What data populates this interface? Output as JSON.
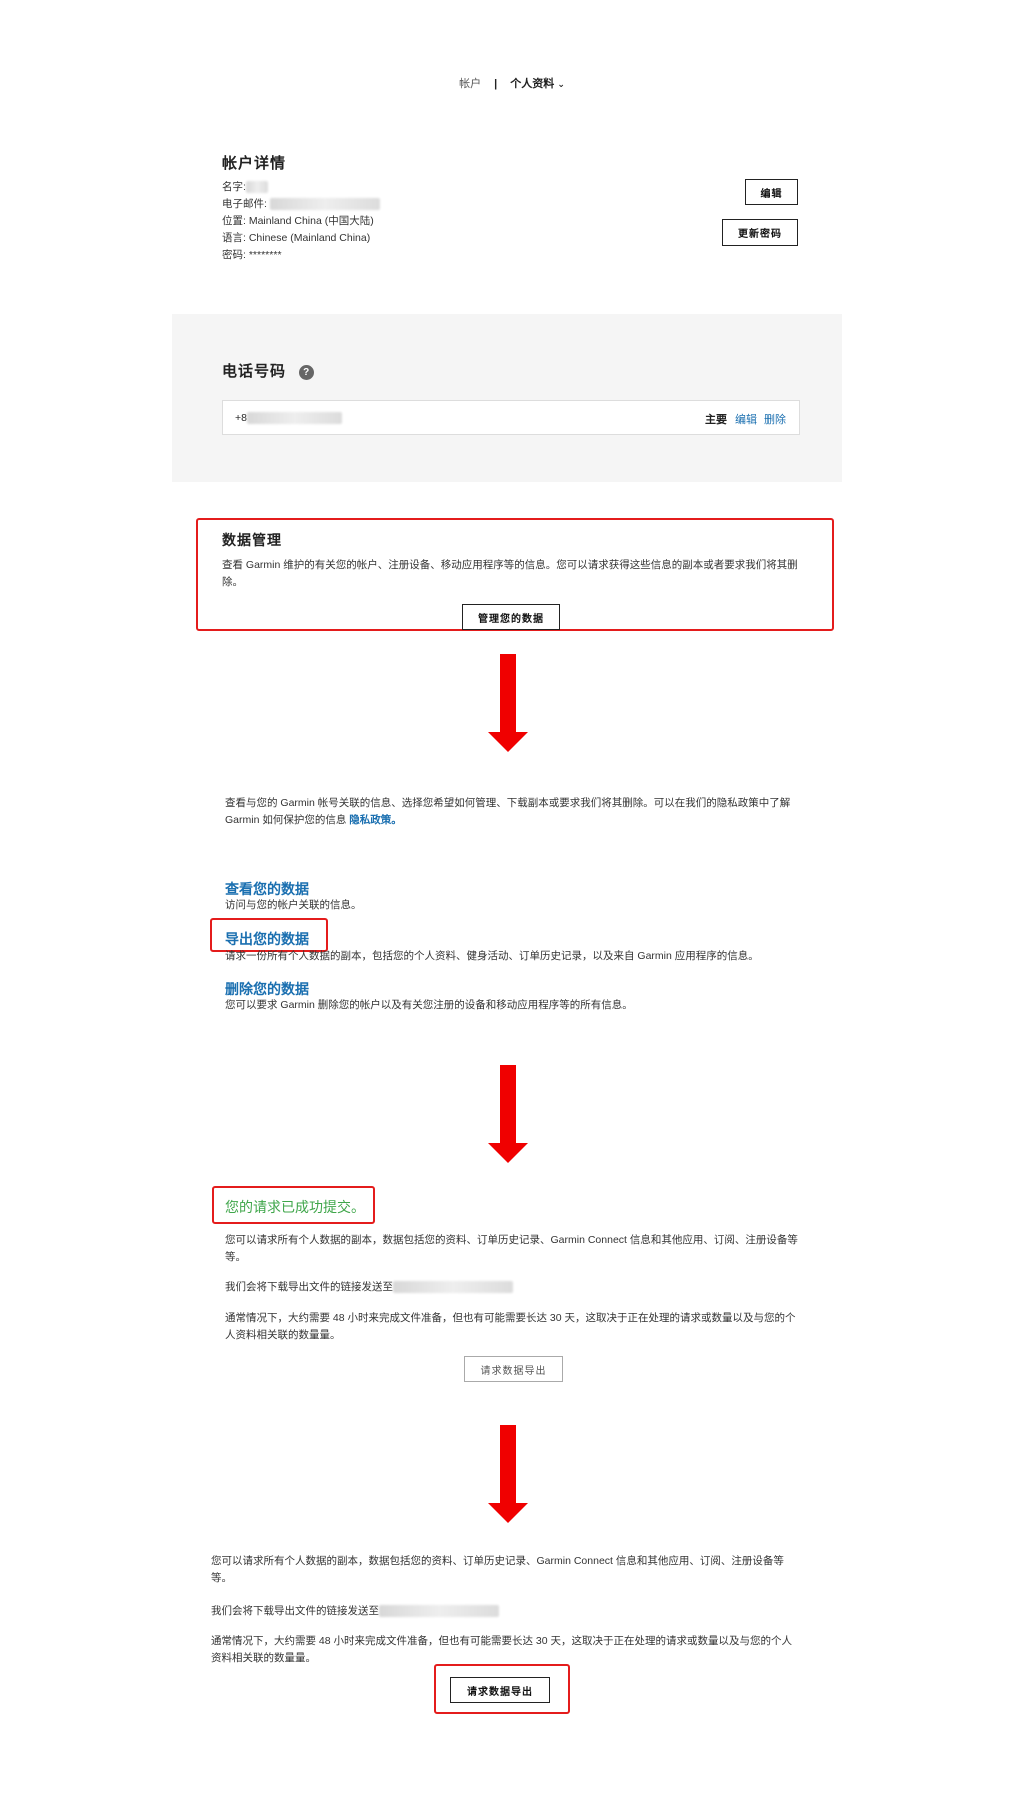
{
  "nav": {
    "account": "帐户",
    "separator": "|",
    "profile": "个人资料"
  },
  "account_details": {
    "title": "帐户详情",
    "name_label": "名字:",
    "email_label": "电子邮件:",
    "location": "位置: Mainland China (中国大陆)",
    "language": "语言: Chinese (Mainland China)",
    "password": "密码: ********",
    "edit_button": "编辑",
    "update_password_button": "更新密码"
  },
  "phone": {
    "title": "电话号码",
    "help_glyph": "?",
    "number_prefix": "+8",
    "primary": "主要",
    "edit": "编辑",
    "delete": "删除"
  },
  "data_management": {
    "title": "数据管理",
    "description": "查看 Garmin 维护的有关您的帐户、注册设备、移动应用程序等的信息。您可以请求获得这些信息的副本或者要求我们将其删除。",
    "button": "管理您的数据"
  },
  "manage_page": {
    "intro": "查看与您的 Garmin 帐号关联的信息、选择您希望如何管理、下载副本或要求我们将其删除。可以在我们的隐私政策中了解 Garmin 如何保护您的信息",
    "privacy_link": "隐私政策。",
    "view_title": "查看您的数据",
    "view_desc": "访问与您的帐户关联的信息。",
    "export_title": "导出您的数据",
    "export_desc": "请求一份所有个人数据的副本，包括您的个人资料、健身活动、订单历史记录，以及来自 Garmin 应用程序的信息。",
    "delete_title": "删除您的数据",
    "delete_desc": "您可以要求 Garmin 删除您的帐户以及有关您注册的设备和移动应用程序等的所有信息。"
  },
  "success_page": {
    "success": "您的请求已成功提交。",
    "p1": "您可以请求所有个人数据的副本，数据包括您的资料、订单历史记录、Garmin Connect 信息和其他应用、订阅、注册设备等等。",
    "p2": "我们会将下载导出文件的链接发送至",
    "p3": "通常情况下，大约需要 48 小时来完成文件准备，但也有可能需要长达 30 天，这取决于正在处理的请求或数量以及与您的个人资料相关联的数量量。",
    "button": "请求数据导出"
  },
  "request_page": {
    "p1": "您可以请求所有个人数据的副本，数据包括您的资料、订单历史记录、Garmin Connect 信息和其他应用、订阅、注册设备等等。",
    "p2": "我们会将下载导出文件的链接发送至",
    "p3": "通常情况下，大约需要 48 小时来完成文件准备，但也有可能需要长达 30 天，这取决于正在处理的请求或数量以及与您的个人资料相关联的数量量。",
    "button": "请求数据导出"
  },
  "colors": {
    "highlight": "#e41c1c",
    "arrow": "#f00000",
    "link": "#1a6fb0",
    "success": "#3fa64a"
  }
}
